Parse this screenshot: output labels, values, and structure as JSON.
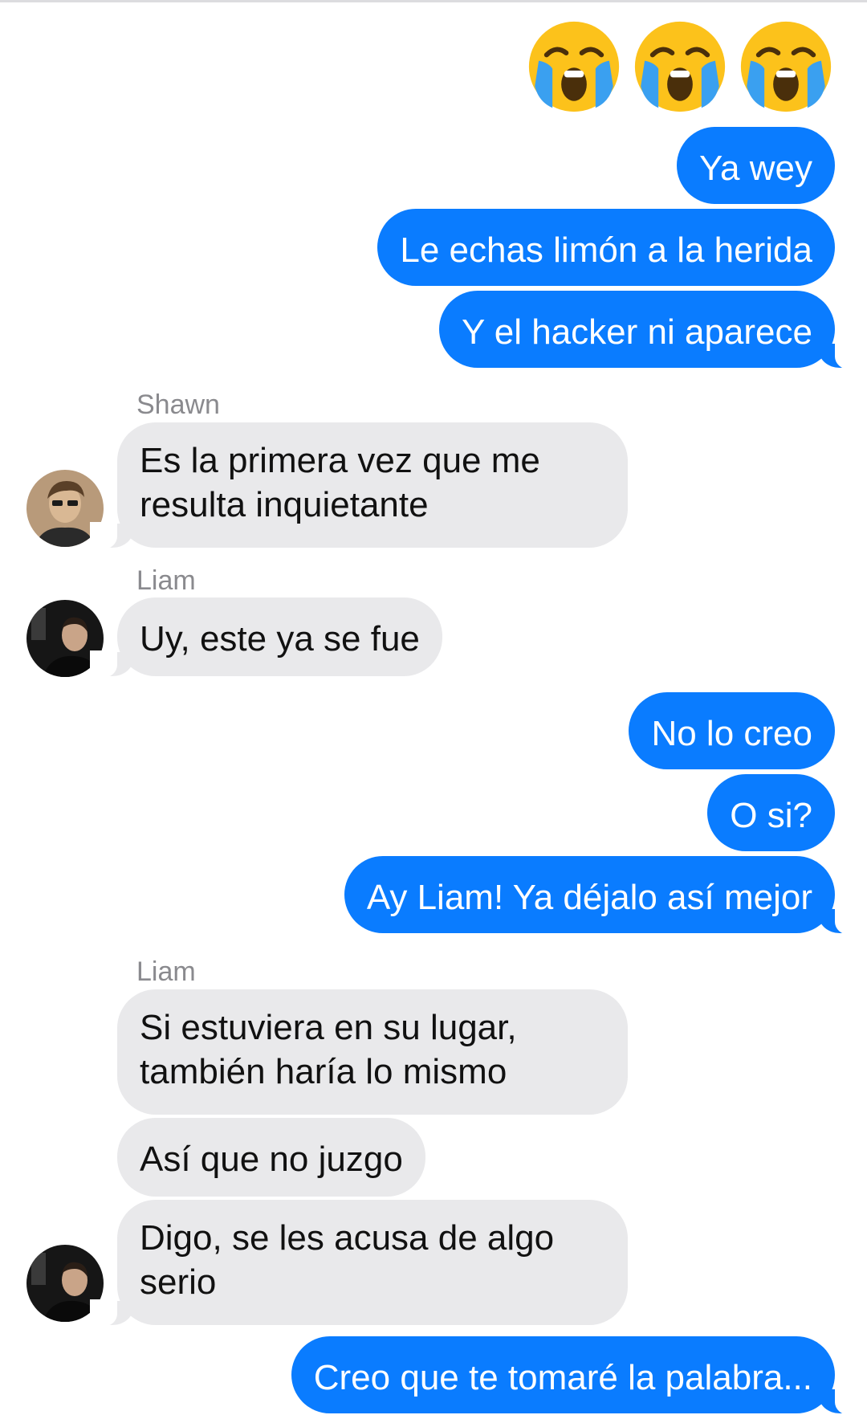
{
  "top_emojis": [
    "loudly-crying-face",
    "loudly-crying-face",
    "loudly-crying-face"
  ],
  "colors": {
    "outgoing": "#0a7cff",
    "incoming": "#e9e9eb",
    "sender_name": "#8a8a8e"
  },
  "messages": [
    {
      "dir": "out",
      "text": "Ya wey"
    },
    {
      "dir": "out",
      "text": "Le echas limón a la herida"
    },
    {
      "dir": "out",
      "text": "Y el hacker ni aparece"
    },
    {
      "dir": "in",
      "sender": "Shawn",
      "text": "Es la primera vez que me resulta inquietante"
    },
    {
      "dir": "in",
      "sender": "Liam",
      "text": "Uy, este ya se fue"
    },
    {
      "dir": "out",
      "text": "No lo creo"
    },
    {
      "dir": "out",
      "text": "O si?"
    },
    {
      "dir": "out",
      "text": "Ay Liam! Ya déjalo así mejor"
    },
    {
      "dir": "in",
      "sender": "Liam",
      "text": "Si estuviera en su lugar, también haría lo mismo"
    },
    {
      "dir": "in",
      "text": "Así que no juzgo"
    },
    {
      "dir": "in",
      "text": "Digo, se les acusa de algo serio"
    },
    {
      "dir": "out",
      "text": "Creo que te tomaré la palabra..."
    }
  ]
}
